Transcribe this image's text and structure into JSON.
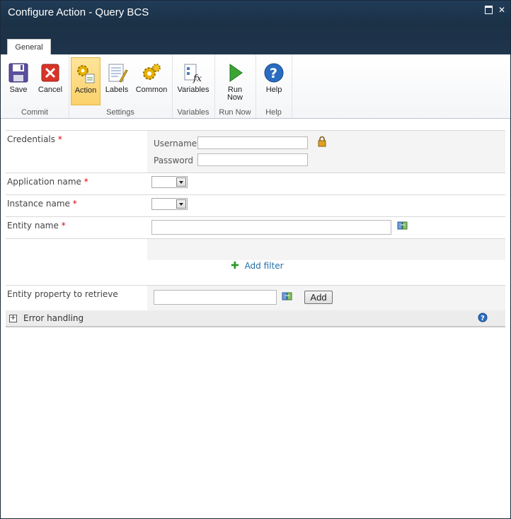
{
  "window": {
    "title": "Configure Action - Query BCS"
  },
  "tabs": [
    {
      "label": "General"
    }
  ],
  "ribbon": {
    "groups": [
      {
        "label": "Commit",
        "buttons": [
          {
            "label": "Save",
            "icon": "save-icon"
          },
          {
            "label": "Cancel",
            "icon": "cancel-icon"
          }
        ]
      },
      {
        "label": "Settings",
        "buttons": [
          {
            "label": "Action",
            "icon": "action-gears-icon",
            "active": true
          },
          {
            "label": "Labels",
            "icon": "labels-icon"
          },
          {
            "label": "Common",
            "icon": "common-gears-icon"
          }
        ]
      },
      {
        "label": "Variables",
        "buttons": [
          {
            "label": "Variables",
            "icon": "variables-fx-icon"
          }
        ]
      },
      {
        "label": "Run Now",
        "buttons": [
          {
            "label_line1": "Run",
            "label_line2": "Now",
            "icon": "run-play-icon"
          }
        ]
      },
      {
        "label": "Help",
        "buttons": [
          {
            "label": "Help",
            "icon": "help-icon"
          }
        ]
      }
    ]
  },
  "form": {
    "required_marker": "*",
    "credentials": {
      "label": "Credentials",
      "username_label": "Username",
      "password_label": "Password",
      "username_value": "",
      "password_value": ""
    },
    "application_name": {
      "label": "Application name",
      "selected": ""
    },
    "instance_name": {
      "label": "Instance name",
      "selected": ""
    },
    "entity_name": {
      "label": "Entity name",
      "value": ""
    },
    "add_filter": {
      "label": "Add filter"
    },
    "entity_property": {
      "label": "Entity property to retrieve",
      "value": "",
      "add_label": "Add"
    },
    "error_handling": {
      "label": "Error handling",
      "expander": "+"
    }
  }
}
